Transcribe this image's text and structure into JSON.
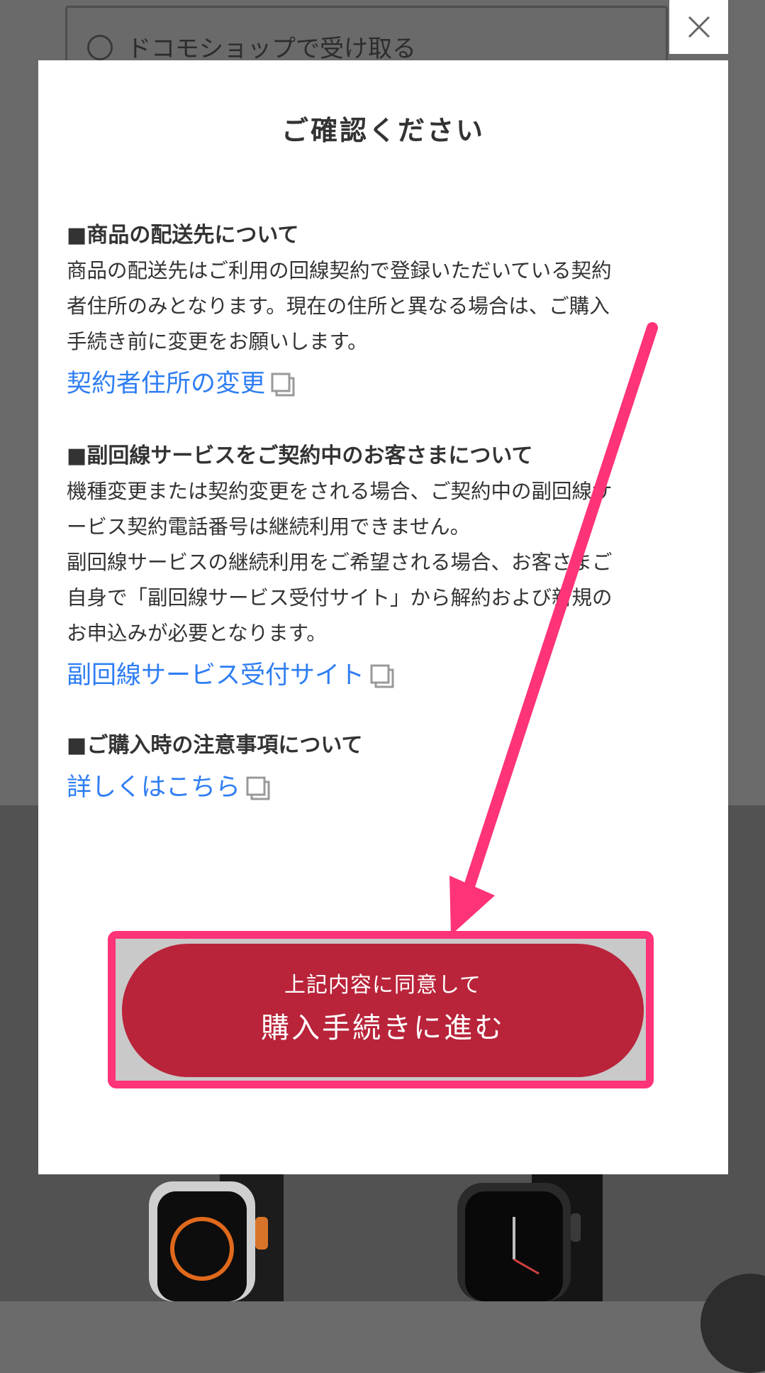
{
  "background": {
    "delivery_option_label": "ドコモショップで受け取る"
  },
  "modal": {
    "title": "ご確認ください",
    "close_label": "×",
    "sections": [
      {
        "heading": "■商品の配送先について",
        "lines": [
          "商品の配送先はご利用の回線契約で登録いただいている契約",
          "者住所のみとなります。現在の住所と異なる場合は、ご購入",
          "手続き前に変更をお願いします。"
        ],
        "link": "契約者住所の変更"
      },
      {
        "heading": "■副回線サービスをご契約中のお客さまについて",
        "lines": [
          "機種変更または契約変更をされる場合、ご契約中の副回線サ",
          "ービス契約電話番号は継続利用できません。",
          "副回線サービスの継続利用をご希望される場合、お客さまご",
          "自身で「副回線サービス受付サイト」から解約および新規の",
          "お申込みが必要となります。"
        ],
        "link": "副回線サービス受付サイト"
      },
      {
        "heading": "■ご購入時の注意事項について",
        "lines": [],
        "link": "詳しくはこちら"
      }
    ],
    "cta": {
      "sub_label": "上記内容に同意して",
      "main_label": "購入手続きに進む"
    }
  },
  "icons": {
    "close": "close-icon",
    "external_link": "external-link-icon",
    "annotation_arrow": "arrow-icon"
  },
  "colors": {
    "link": "#2f7ef3",
    "cta": "#b9243a",
    "highlight": "#ff3377"
  }
}
